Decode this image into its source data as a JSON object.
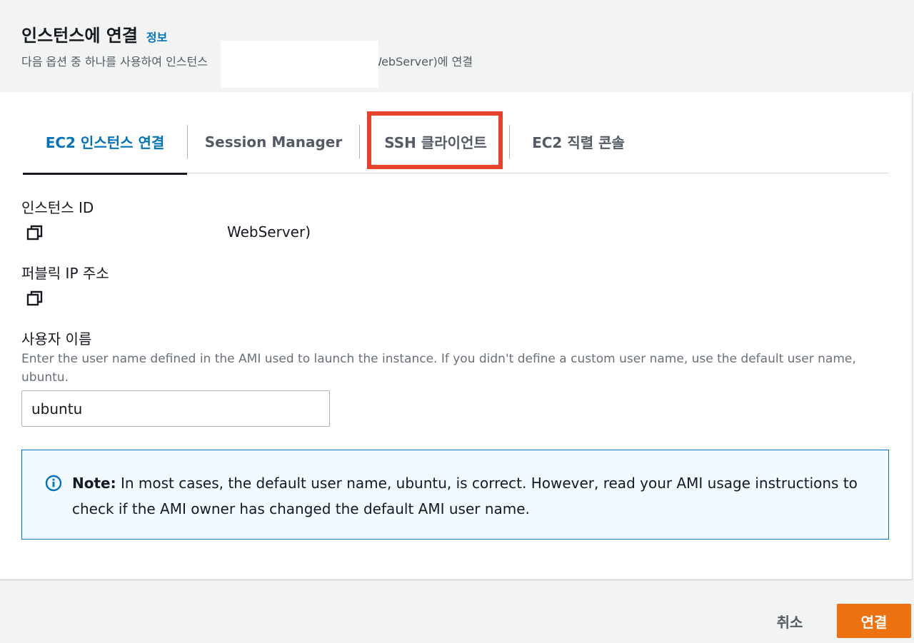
{
  "header": {
    "title": "인스턴스에 연결",
    "info_link": "정보",
    "subtitle_prefix": "다음 옵션 중 하나를 사용하여 인스턴스",
    "subtitle_suffix": "(WebServer)에 연결"
  },
  "tabs": [
    {
      "label": "EC2 인스턴스 연결",
      "active": true
    },
    {
      "label": "Session Manager",
      "active": false
    },
    {
      "label": "SSH 클라이언트",
      "active": false,
      "highlighted": true
    },
    {
      "label": "EC2 직렬 콘솔",
      "active": false
    }
  ],
  "instance_id": {
    "label": "인스턴스 ID",
    "value": "WebServer)",
    "icon": "copy-icon"
  },
  "public_ip": {
    "label": "퍼블릭 IP 주소",
    "icon": "copy-icon"
  },
  "username": {
    "label": "사용자 이름",
    "description": "Enter the user name defined in the AMI used to launch the instance. If you didn't define a custom user name, use the default user name, ubuntu.",
    "value": "ubuntu"
  },
  "note": {
    "icon": "info-icon",
    "bold": "Note:",
    "text": " In most cases, the default user name, ubuntu, is correct. However, read your AMI usage instructions to check if the AMI owner has changed the default AMI user name."
  },
  "footer": {
    "cancel_label": "취소",
    "connect_label": "연결"
  },
  "colors": {
    "accent": "#0073bb",
    "primary_button": "#ec7211",
    "highlight": "#e8412c",
    "note_bg": "#f1faff"
  }
}
